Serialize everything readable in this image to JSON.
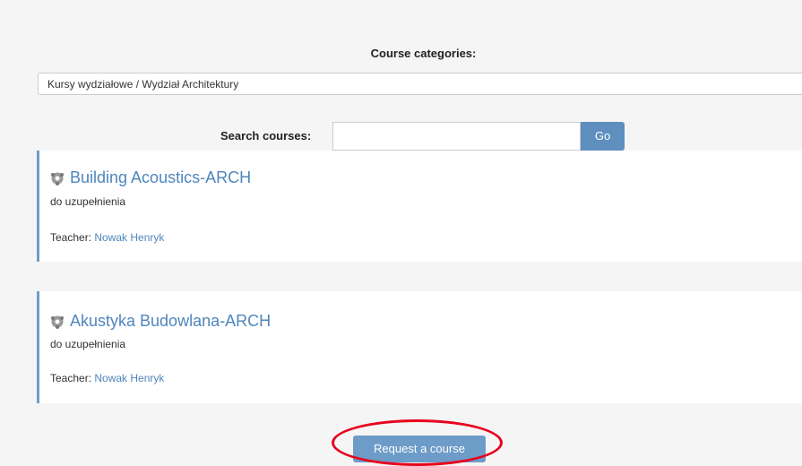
{
  "categories": {
    "label": "Course categories:",
    "selected": "Kursy wydziałowe / Wydział Architektury"
  },
  "search": {
    "label": "Search courses:",
    "value": "",
    "placeholder": "",
    "go_label": "Go"
  },
  "courses": [
    {
      "title": "Building Acoustics-ARCH",
      "description": "do uzupełnienia",
      "teacher_label": "Teacher:",
      "teacher_name": "Nowak Henryk"
    },
    {
      "title": "Akustyka Budowlana-ARCH",
      "description": "do uzupełnienia",
      "teacher_label": "Teacher:",
      "teacher_name": "Nowak Henryk"
    }
  ],
  "request_button": "Request a course",
  "colors": {
    "accent": "#4f86bd",
    "button": "#6d9cc8",
    "highlight": "#e8001c"
  }
}
